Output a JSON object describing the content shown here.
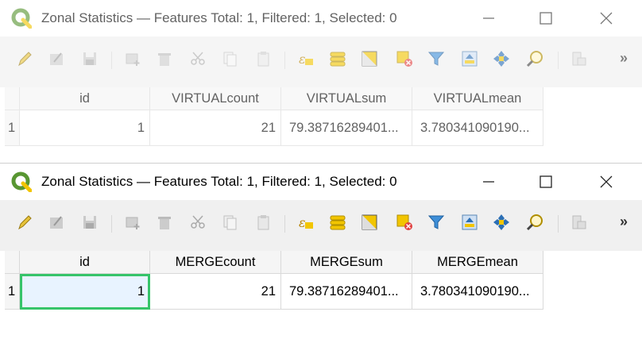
{
  "windows": [
    {
      "title": "Zonal Statistics — Features Total: 1, Filtered: 1, Selected: 0",
      "columns": [
        "id",
        "VIRTUALcount",
        "VIRTUALsum",
        "VIRTUALmean"
      ],
      "row_header": "1",
      "row": [
        "1",
        "21",
        "79.38716289401...",
        "3.780341090190..."
      ]
    },
    {
      "title": "Zonal Statistics — Features Total: 1, Filtered: 1, Selected: 0",
      "columns": [
        "id",
        "MERGEcount",
        "MERGEsum",
        "MERGEmean"
      ],
      "row_header": "1",
      "row": [
        "1",
        "21",
        "79.38716289401...",
        "3.780341090190..."
      ]
    }
  ],
  "toolbar": {
    "icons": [
      "pencil-icon",
      "multi-edit-icon",
      "save-edits-icon",
      "add-feature-icon",
      "delete-feature-icon",
      "cut-icon",
      "copy-icon",
      "paste-icon",
      "expression-select-icon",
      "select-all-icon",
      "invert-selection-icon",
      "deselect-icon",
      "filter-icon",
      "move-selection-top-icon",
      "pan-to-selection-icon",
      "zoom-to-selection-icon",
      "new-field-icon"
    ],
    "overflow": "»"
  },
  "colors": {
    "qgis_green": "#589632",
    "selection_outline": "#36c46a",
    "accent_yellow": "#f2c500"
  }
}
